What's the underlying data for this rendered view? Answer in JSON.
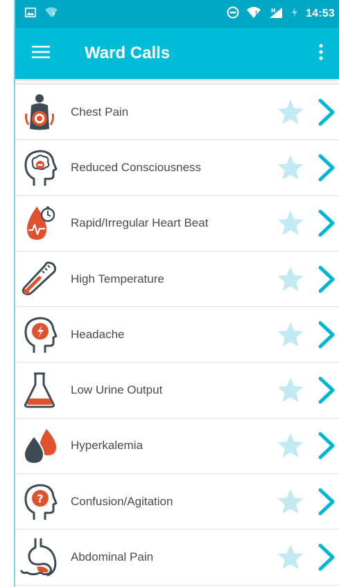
{
  "status_bar": {
    "time": "14:53",
    "icons": [
      "image-icon",
      "wifi-question-icon",
      "do-not-disturb-icon",
      "wifi-icon",
      "signal-h-icon",
      "charging-bolt-icon"
    ]
  },
  "app_bar": {
    "title": "Ward Calls",
    "menu_icon": "hamburger-menu-icon",
    "more_icon": "more-vert-icon"
  },
  "colors": {
    "status_bar": "#00a8c6",
    "app_bar": "#00bcd8",
    "chevron": "#00b7d4",
    "star": "#c3eaf3",
    "icon_dark": "#3d4b55",
    "icon_red": "#e0522d"
  },
  "items": [
    {
      "label": "Chest Pain",
      "icon": "chest-pain-icon"
    },
    {
      "label": "Reduced Consciousness",
      "icon": "reduced-consciousness-icon"
    },
    {
      "label": "Rapid/Irregular Heart Beat",
      "icon": "heart-beat-icon"
    },
    {
      "label": "High Temperature",
      "icon": "thermometer-icon"
    },
    {
      "label": "Headache",
      "icon": "headache-icon"
    },
    {
      "label": "Low Urine Output",
      "icon": "flask-icon"
    },
    {
      "label": "Hyperkalemia",
      "icon": "drops-icon"
    },
    {
      "label": "Confusion/Agitation",
      "icon": "confusion-icon"
    },
    {
      "label": "Abdominal Pain",
      "icon": "stomach-icon"
    }
  ]
}
